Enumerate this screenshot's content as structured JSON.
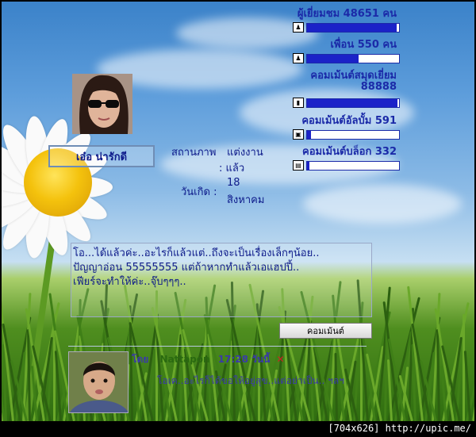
{
  "stats": {
    "visitors": {
      "label": "ผู้เยี่ยมชม 48651 คน",
      "icon": "user-icon",
      "fill": 0.97
    },
    "friends": {
      "label": "เพื่อน 550 คน",
      "icon": "user-icon",
      "fill": 0.56
    },
    "guestbook_comments": {
      "label_line1": "คอมเม้นต์สมุดเยี่ยม",
      "label_line2": "88888",
      "icon": "book-icon",
      "fill": 0.98
    },
    "album_comments": {
      "label": "คอมเม้นต์อัลบั้ม 591",
      "icon": "photo-icon",
      "fill": 0.04
    },
    "blog_comments": {
      "label": "คอมเม้นต์บล็อก 332",
      "icon": "chat-icon",
      "fill": 0.03
    }
  },
  "profile": {
    "name": "เอ๋อ น่ารักดี",
    "status_label": "สถานภาพ",
    "status_value_line1": "แต่งงาน",
    "status_value_line2": ": แล้ว",
    "birthday_label": "วันเกิด :",
    "birthday_day": "18",
    "birthday_month": "สิงหาคม"
  },
  "status_message": {
    "line1": "โอ...ได้แล้วค่ะ..อะไรก็แล้วแต่..ถึงจะเป็นเรื่องเล็กๆน้อย..",
    "line2": "ปัญญาอ่อน 55555555 แต่ถ้าหากทำแล้วเอแฮปปี้..",
    "line3": "เฟียร์จะทำให้ค่ะ..จุ๊บๆๆๆ.."
  },
  "comment_button": "คอมเม้นต์",
  "comment": {
    "name_prefix": "โดย",
    "author": "Nattapon",
    "time": "17:28 วันนี้",
    "close_symbol": "✕",
    "text": "โอเค..อะไรก็ได้ขอให้อยู่สุข..แต่อย่าเป็น.. ฯลฯ"
  },
  "watermark": "[704x626] http://upic.me/",
  "colors": {
    "accent": "#1b22c8",
    "text": "#0d1a8a"
  }
}
